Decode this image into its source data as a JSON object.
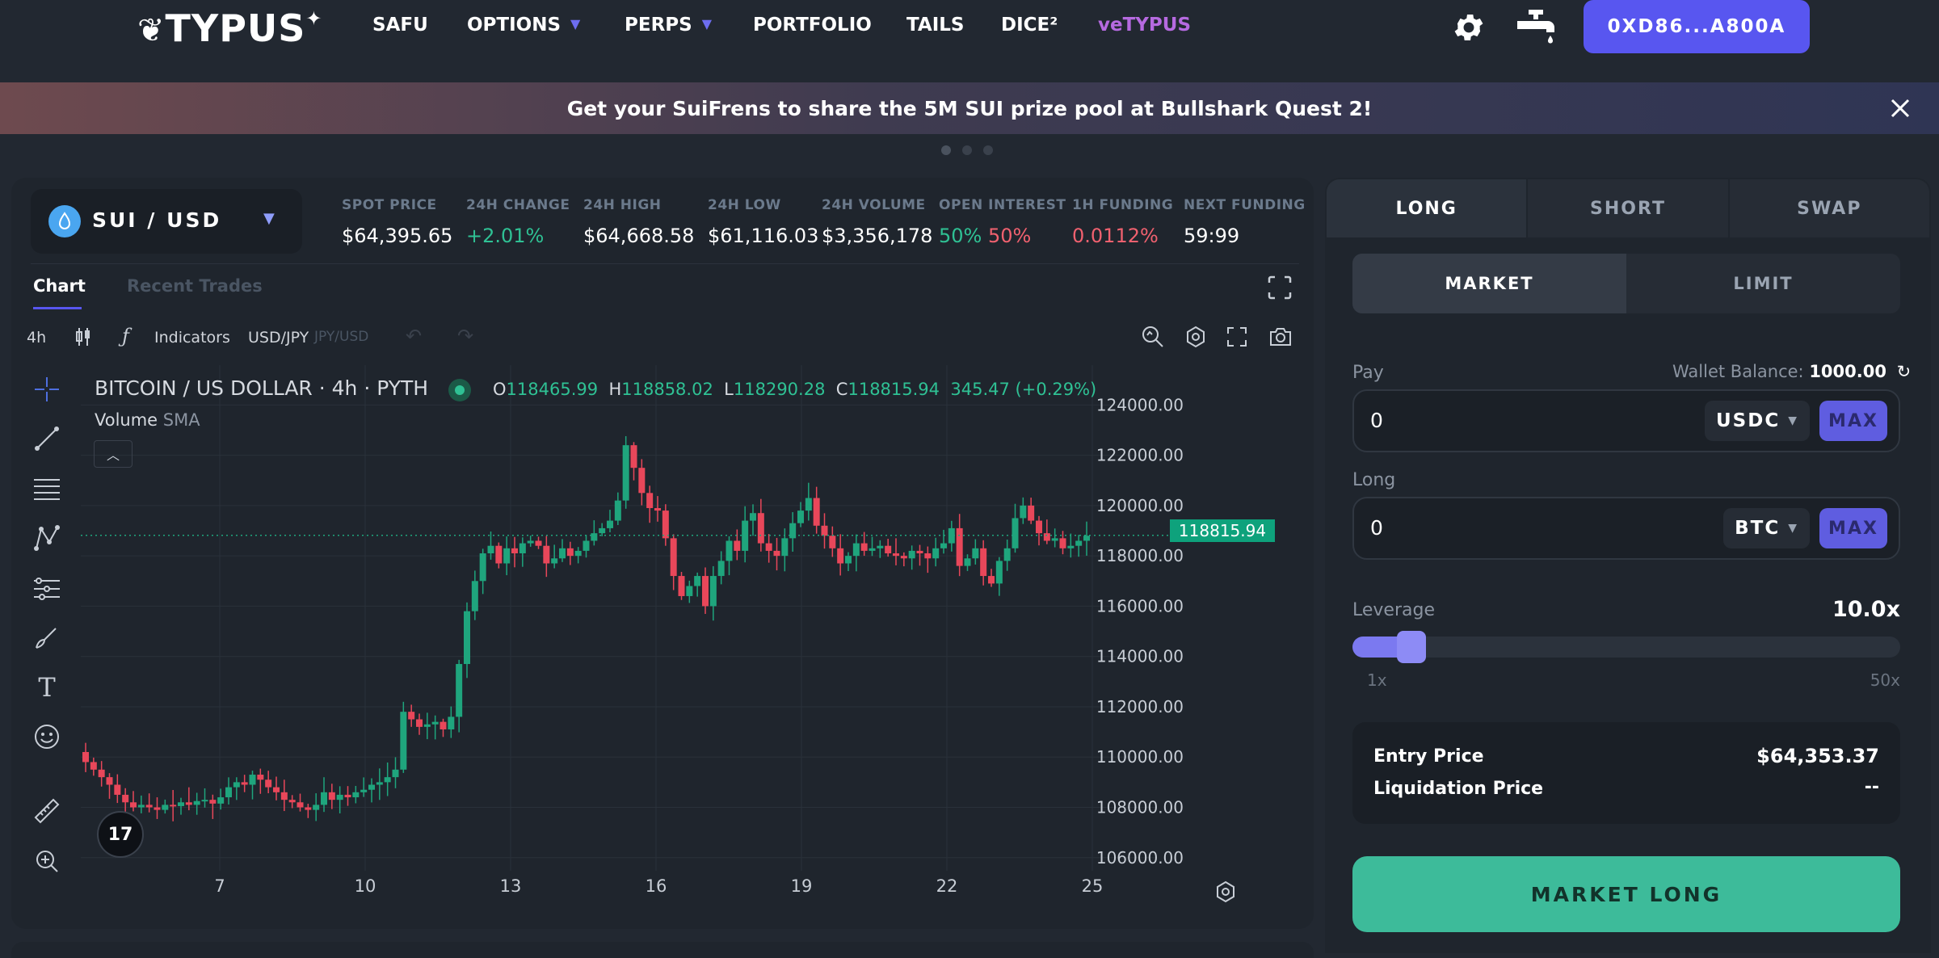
{
  "nav": {
    "logo": "TYPUS",
    "links": [
      {
        "label": "SAFU",
        "dropdown": false
      },
      {
        "label": "OPTIONS",
        "dropdown": true
      },
      {
        "label": "PERPS",
        "dropdown": true
      },
      {
        "label": "PORTFOLIO",
        "dropdown": false
      },
      {
        "label": "TAILS",
        "dropdown": false
      },
      {
        "label": "DICE²",
        "dropdown": false
      },
      {
        "label": "veTYPUS",
        "dropdown": false
      }
    ],
    "settings_icon": "gear-icon",
    "faucet_icon": "faucet-icon",
    "wallet": "0XD86...A800A"
  },
  "banner": {
    "text": "Get your SuiFrens to share the 5M SUI prize pool at Bullshark Quest 2!",
    "close_icon": "close-icon"
  },
  "market": {
    "pair": "SUI / USD",
    "stats": [
      {
        "label": "SPOT PRICE",
        "value": "$64,395.65"
      },
      {
        "label": "24H CHANGE",
        "value": "+2.01%"
      },
      {
        "label": "24H HIGH",
        "value": "$64,668.58"
      },
      {
        "label": "24H LOW",
        "value": "$61,116.03"
      },
      {
        "label": "24H VOLUME",
        "value": "$3,356,178"
      },
      {
        "label": "OPEN INTEREST",
        "value_long": "50%",
        "value_short": "50%"
      },
      {
        "label": "1H FUNDING",
        "value": "0.0112%"
      },
      {
        "label": "NEXT FUNDING",
        "value": "59:99"
      }
    ]
  },
  "chart_tabs": {
    "chart": "Chart",
    "recent_trades": "Recent Trades"
  },
  "toolbar": {
    "interval": "4h",
    "indicators": "Indicators",
    "symbol": "USD/JPY",
    "symbol_alt": "JPY/USD"
  },
  "chart_legend": {
    "title": "BITCOIN / US DOLLAR · 4h · PYTH",
    "o_label": "O",
    "o": "118465.99",
    "h_label": "H",
    "h": "118858.02",
    "l_label": "L",
    "l": "118290.28",
    "c_label": "C",
    "c": "118815.94",
    "change": "345.47 (+0.29%)",
    "volume": "Volume",
    "volume_sub": "SMA",
    "last_price": "118815.94"
  },
  "chart_data": {
    "type": "candlestick",
    "title": "BITCOIN / US DOLLAR · 4h · PYTH",
    "y_ticks": [
      "124000.00",
      "122000.00",
      "120000.00",
      "118000.00",
      "116000.00",
      "114000.00",
      "112000.00",
      "110000.00",
      "108000.00",
      "106000.00"
    ],
    "x_ticks": [
      "7",
      "10",
      "13",
      "16",
      "19",
      "22",
      "25"
    ],
    "ylim": [
      105000,
      124800
    ],
    "closes": [
      109800,
      109500,
      109200,
      108900,
      108500,
      108200,
      108000,
      108100,
      108000,
      107900,
      108100,
      108050,
      108200,
      108100,
      108250,
      108300,
      108150,
      108400,
      108800,
      109000,
      108900,
      109300,
      109100,
      108800,
      108600,
      108300,
      108200,
      108000,
      107900,
      108100,
      108600,
      108300,
      108500,
      108400,
      108600,
      108700,
      108900,
      109000,
      109200,
      109500,
      111800,
      111500,
      111200,
      111300,
      111400,
      111100,
      111600,
      113700,
      115800,
      117000,
      118100,
      118400,
      117700,
      118300,
      118100,
      118500,
      118600,
      118400,
      117700,
      117900,
      118300,
      118000,
      118200,
      118600,
      118900,
      119100,
      119400,
      120200,
      122400,
      121500,
      120500,
      119900,
      119800,
      118700,
      117200,
      116400,
      116800,
      117200,
      116000,
      117200,
      117800,
      118600,
      118200,
      119400,
      119700,
      118500,
      118200,
      118000,
      118700,
      119300,
      119800,
      120300,
      119200,
      118800,
      118300,
      117700,
      118000,
      118500,
      118200,
      118300,
      118400,
      118100,
      118000,
      117900,
      118200,
      118100,
      117900,
      118300,
      118500,
      119100,
      117600,
      117900,
      118300,
      117200,
      116900,
      117800,
      118300,
      119500,
      120000,
      119400,
      118900,
      118600,
      118700,
      118300,
      118400,
      118600,
      118800
    ]
  },
  "order": {
    "tabs": [
      "LONG",
      "SHORT",
      "SWAP"
    ],
    "types": [
      "MARKET",
      "LIMIT"
    ],
    "pay_label": "Pay",
    "wallet_balance_label": "Wallet Balance:",
    "wallet_balance": "1000.00",
    "pay_value": "0",
    "pay_token": "USDC",
    "max": "MAX",
    "long_label": "Long",
    "long_value": "0",
    "long_token": "BTC",
    "leverage_label": "Leverage",
    "leverage_value": "10.0x",
    "leverage_level": 0.18,
    "lev_min": "1x",
    "lev_max": "50x",
    "entry_price_label": "Entry Price",
    "entry_price": "$64,353.37",
    "liq_price_label": "Liquidation Price",
    "liq_price": "--",
    "submit": "MARKET LONG"
  },
  "colors": {
    "accent": "#5856f0",
    "up": "#2fc194",
    "down": "#f0616f",
    "cta": "#3dbb9a"
  }
}
